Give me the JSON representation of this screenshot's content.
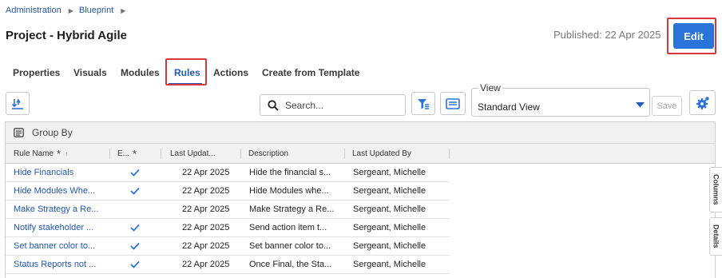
{
  "breadcrumb": {
    "items": [
      "Administration",
      "Blueprint"
    ]
  },
  "page": {
    "title": "Project - Hybrid Agile",
    "published": "Published: 22 Apr 2025",
    "edit_label": "Edit"
  },
  "tabs": [
    {
      "label": "Properties"
    },
    {
      "label": "Visuals"
    },
    {
      "label": "Modules"
    },
    {
      "label": "Rules",
      "active": true
    },
    {
      "label": "Actions"
    },
    {
      "label": "Create from Template"
    }
  ],
  "toolbar": {
    "search_placeholder": "Search...",
    "view_legend": "View",
    "view_value": "Standard View",
    "save_label": "Save"
  },
  "grid": {
    "group_by_label": "Group By",
    "columns": [
      "Rule Name",
      "E...",
      "Last Updat...",
      "Description",
      "Last Updated By"
    ],
    "rows": [
      {
        "name": "Hide Financials",
        "enabled": true,
        "updated": "22 Apr 2025",
        "description": "Hide the financial s...",
        "updated_by": "Sergeant, Michelle"
      },
      {
        "name": "Hide Modules Whe...",
        "enabled": true,
        "updated": "22 Apr 2025",
        "description": "Hide Modules whe...",
        "updated_by": "Sergeant, Michelle"
      },
      {
        "name": "Make Strategy a Re...",
        "enabled": false,
        "updated": "22 Apr 2025",
        "description": "Make Strategy a Re...",
        "updated_by": "Sergeant, Michelle"
      },
      {
        "name": "Notify stakeholder ...",
        "enabled": true,
        "updated": "22 Apr 2025",
        "description": "Send action item t...",
        "updated_by": "Sergeant, Michelle"
      },
      {
        "name": "Set banner color to...",
        "enabled": true,
        "updated": "22 Apr 2025",
        "description": "Set banner color to...",
        "updated_by": "Sergeant, Michelle"
      },
      {
        "name": "Status Reports not ...",
        "enabled": true,
        "updated": "22 Apr 2025",
        "description": "Once Final, the Sta...",
        "updated_by": "Sergeant, Michelle"
      }
    ]
  },
  "side_panels": [
    "Columns",
    "Details"
  ],
  "colors": {
    "accent": "#2a73d9",
    "link": "#2156b4",
    "highlight": "#d9383a"
  },
  "icons": [
    "export-download-icon",
    "search-icon",
    "filter-icon",
    "layout-icon",
    "chevron-down-icon",
    "gear-icon",
    "group-by-icon",
    "checkmark-icon"
  ]
}
